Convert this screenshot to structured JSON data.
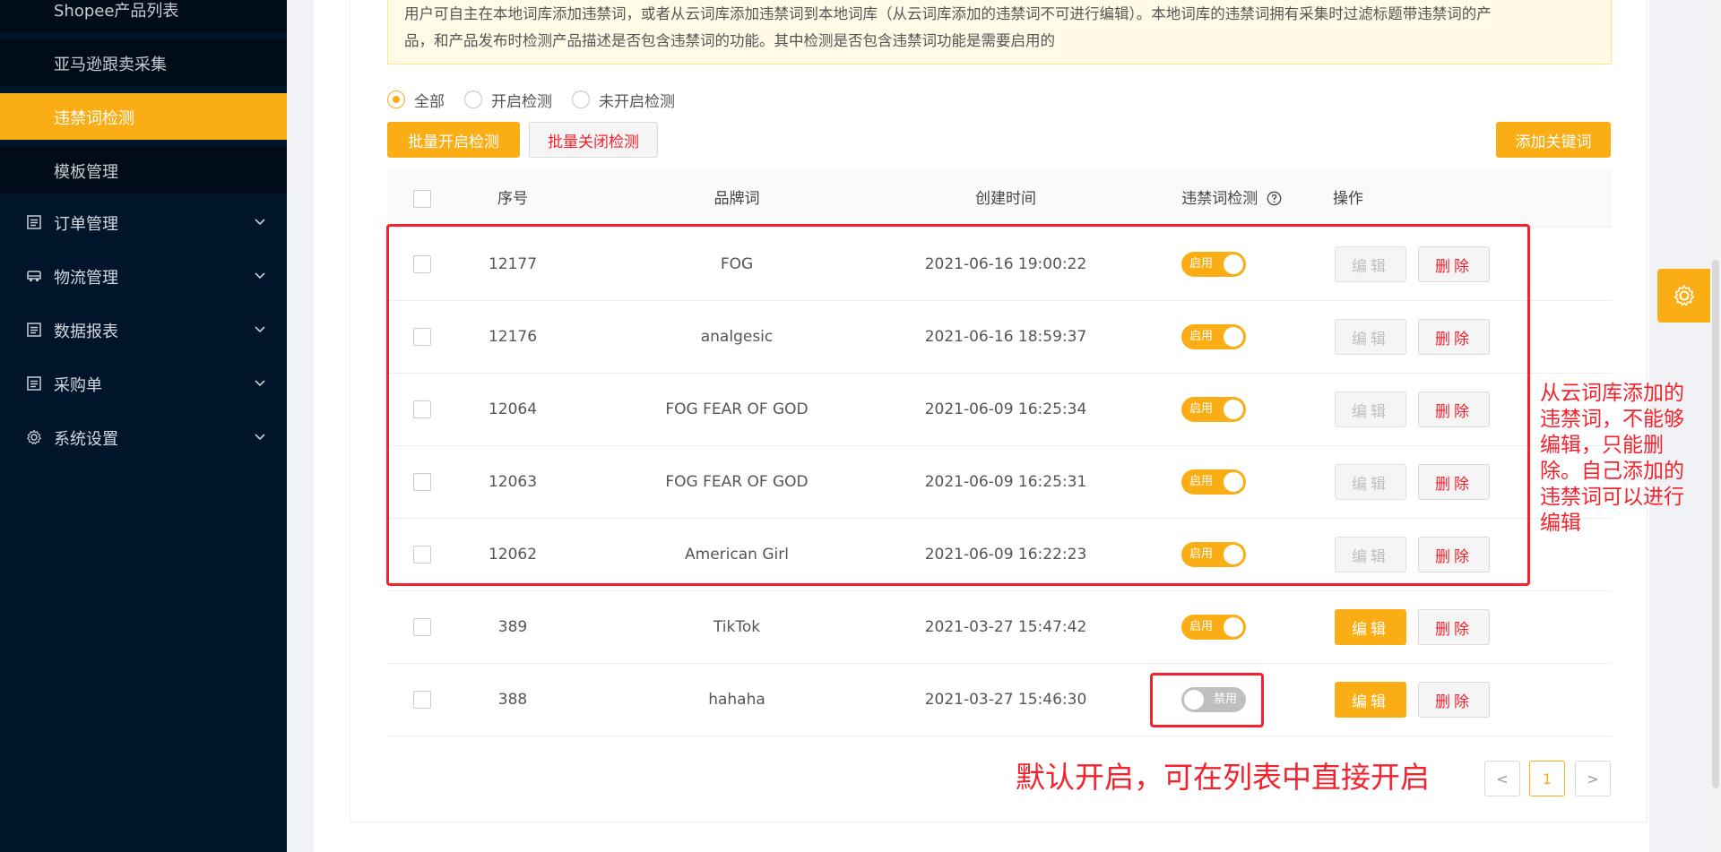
{
  "sidebar": {
    "sub_items": [
      {
        "label": "Shopee产品列表"
      },
      {
        "label": "亚马逊跟卖采集"
      },
      {
        "label": "违禁词检测"
      },
      {
        "label": "模板管理"
      }
    ],
    "items": [
      {
        "label": "订单管理",
        "icon": "list-icon"
      },
      {
        "label": "物流管理",
        "icon": "truck-icon"
      },
      {
        "label": "数据报表",
        "icon": "report-icon"
      },
      {
        "label": "采购单",
        "icon": "list-icon"
      },
      {
        "label": "系统设置",
        "icon": "gear-icon"
      }
    ]
  },
  "notice": {
    "line1": "用户可自主在本地词库添加违禁词，或者从云词库添加违禁词到本地词库（从云词库添加的违禁词不可进行编辑）。本地词库的违禁词拥有采集时过滤标题带违禁词的产",
    "line2": "品，和产品发布时检测产品描述是否包含违禁词的功能。其中检测是否包含违禁词功能是需要启用的"
  },
  "filter": {
    "options": [
      "全部",
      "开启检测",
      "未开启检测"
    ],
    "selected": "全部"
  },
  "buttons": {
    "batch_enable": "批量开启检测",
    "batch_disable": "批量关闭检测",
    "add_keyword": "添加关键词"
  },
  "table": {
    "columns": [
      "序号",
      "品牌词",
      "创建时间",
      "违禁词检测",
      "操作"
    ],
    "edit_label": "编辑",
    "delete_label": "删除",
    "rows": [
      {
        "id": "12177",
        "brand": "FOG",
        "created": "2021-06-16 19:00:22",
        "status": "启用",
        "enabled": true,
        "editable": false
      },
      {
        "id": "12176",
        "brand": "analgesic",
        "created": "2021-06-16 18:59:37",
        "status": "启用",
        "enabled": true,
        "editable": false
      },
      {
        "id": "12064",
        "brand": "FOG FEAR OF GOD",
        "created": "2021-06-09 16:25:34",
        "status": "启用",
        "enabled": true,
        "editable": false
      },
      {
        "id": "12063",
        "brand": "FOG FEAR OF GOD",
        "created": "2021-06-09 16:25:31",
        "status": "启用",
        "enabled": true,
        "editable": false
      },
      {
        "id": "12062",
        "brand": "American Girl",
        "created": "2021-06-09 16:22:23",
        "status": "启用",
        "enabled": true,
        "editable": false
      },
      {
        "id": "389",
        "brand": "TikTok",
        "created": "2021-03-27 15:47:42",
        "status": "启用",
        "enabled": true,
        "editable": true
      },
      {
        "id": "388",
        "brand": "hahaha",
        "created": "2021-03-27 15:46:30",
        "status": "禁用",
        "enabled": false,
        "editable": true
      }
    ]
  },
  "pagination": {
    "prev": "<",
    "current": "1",
    "next": ">"
  },
  "annotations": {
    "side_note_lines": [
      "从云词库添加的",
      "违禁词，不能够",
      "编辑，只能删",
      "除。自己添加的",
      "违禁词可以进行",
      "编辑"
    ],
    "bottom_note": "默认开启，可在列表中直接开启"
  },
  "colors": {
    "accent": "#faad14",
    "sidebar": "#001529",
    "danger": "#f5222d"
  }
}
